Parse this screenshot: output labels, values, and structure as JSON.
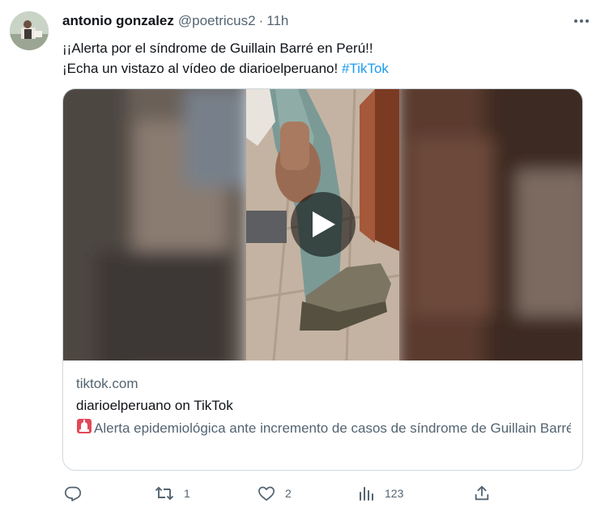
{
  "tweet": {
    "author_name": "antonio gonzalez",
    "author_handle": "@poetricus2",
    "separator": "·",
    "time": "11h",
    "text_line1": "¡¡Alerta por el síndrome de Guillain Barré en Perú!!",
    "text_line2_prefix": "¡Echa un vistazo al vídeo de diarioelperuano! ",
    "hashtag": "#TikTok"
  },
  "card": {
    "domain": "tiktok.com",
    "title": "diarioelperuano on TikTok",
    "description": "Alerta epidemiológica ante incremento de casos de síndrome de Guillain Barré en Lima, La Libertad, Piura, Callao, Cajamarca, Junín, y ..."
  },
  "actions": {
    "reply_count": "",
    "retweet_count": "1",
    "like_count": "2",
    "views_count": "123"
  },
  "icons": [
    "avatar",
    "more-icon",
    "play-icon",
    "siren-icon",
    "reply-icon",
    "retweet-icon",
    "like-icon",
    "views-icon",
    "share-icon"
  ],
  "colors": {
    "accent": "#1d9bf0",
    "muted": "#536471",
    "text": "#0f1419",
    "border": "#cfd9de"
  }
}
